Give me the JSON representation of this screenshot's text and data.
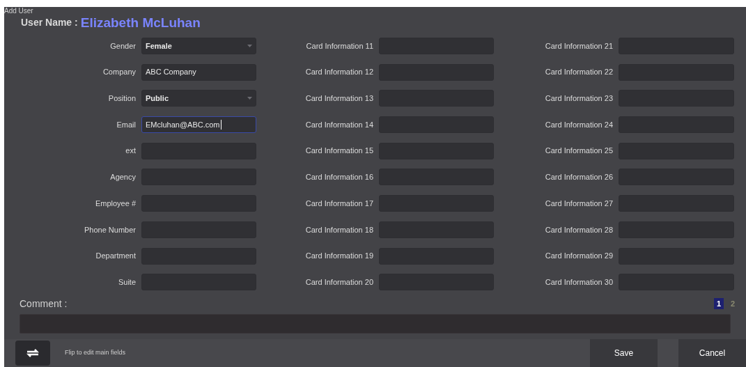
{
  "window": {
    "title": "Add User"
  },
  "user_name": {
    "label": "User Name :",
    "value": "Elizabeth McLuhan"
  },
  "main_fields": [
    {
      "label": "Gender",
      "kind": "select",
      "value": "Female",
      "focused": false
    },
    {
      "label": "Company",
      "kind": "text",
      "value": "ABC Company",
      "focused": false
    },
    {
      "label": "Position",
      "kind": "select",
      "value": "Public",
      "focused": false
    },
    {
      "label": "Email",
      "kind": "text",
      "value": "EMcluhan@ABC.com",
      "focused": true
    },
    {
      "label": "ext",
      "kind": "text",
      "focused": false
    },
    {
      "label": "Agency",
      "kind": "text",
      "focused": false
    },
    {
      "label": "Employee #",
      "kind": "text",
      "focused": false
    },
    {
      "label": "Phone Number",
      "kind": "text",
      "focused": false
    },
    {
      "label": "Department",
      "kind": "text",
      "focused": false
    },
    {
      "label": "Suite",
      "kind": "text",
      "focused": false
    }
  ],
  "card_fields_1": [
    "Card Information 11",
    "Card Information 12",
    "Card Information 13",
    "Card Information 14",
    "Card Information 15",
    "Card Information 16",
    "Card Information 17",
    "Card Information 18",
    "Card Information 19",
    "Card Information 20"
  ],
  "card_fields_2": [
    "Card Information 21",
    "Card Information 22",
    "Card Information 23",
    "Card Information 24",
    "Card Information 25",
    "Card Information 26",
    "Card Information 27",
    "Card Information 28",
    "Card Information 29",
    "Card Information 30"
  ],
  "comment": {
    "label": "Comment :"
  },
  "pages": [
    {
      "label": "1",
      "selected": true
    },
    {
      "label": "2",
      "selected": false
    }
  ],
  "footer": {
    "flip_hint": "Flip to edit main fields",
    "buttons": [
      "Save",
      "Cancel"
    ]
  }
}
